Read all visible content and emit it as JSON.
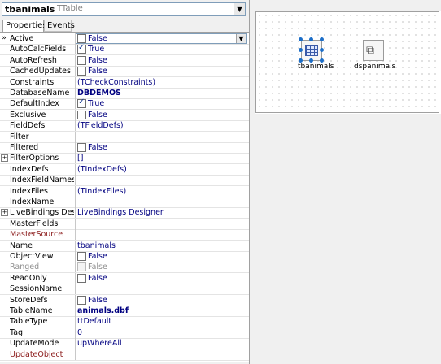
{
  "object_selector": {
    "name": "tbanimals",
    "class_name": "TTable"
  },
  "tabs": [
    {
      "label": "Properties"
    },
    {
      "label": "Events"
    }
  ],
  "properties": [
    {
      "name": "Active",
      "value": "False",
      "kind": "check",
      "checked": false,
      "editing": true
    },
    {
      "name": "AutoCalcFields",
      "value": "True",
      "kind": "check",
      "checked": true
    },
    {
      "name": "AutoRefresh",
      "value": "False",
      "kind": "check",
      "checked": false
    },
    {
      "name": "CachedUpdates",
      "value": "False",
      "kind": "check",
      "checked": false
    },
    {
      "name": "Constraints",
      "value": "(TCheckConstraints)",
      "kind": "navy"
    },
    {
      "name": "DatabaseName",
      "value": "DBDEMOS",
      "kind": "bold"
    },
    {
      "name": "DefaultIndex",
      "value": "True",
      "kind": "check",
      "checked": true
    },
    {
      "name": "Exclusive",
      "value": "False",
      "kind": "check",
      "checked": false
    },
    {
      "name": "FieldDefs",
      "value": "(TFieldDefs)",
      "kind": "navy"
    },
    {
      "name": "Filter",
      "value": "",
      "kind": "text"
    },
    {
      "name": "Filtered",
      "value": "False",
      "kind": "check",
      "checked": false
    },
    {
      "name": "FilterOptions",
      "value": "[]",
      "kind": "navy",
      "expandable": true
    },
    {
      "name": "IndexDefs",
      "value": "(TIndexDefs)",
      "kind": "navy"
    },
    {
      "name": "IndexFieldNames",
      "value": "",
      "kind": "text"
    },
    {
      "name": "IndexFiles",
      "value": "(TIndexFiles)",
      "kind": "navy"
    },
    {
      "name": "IndexName",
      "value": "",
      "kind": "text"
    },
    {
      "name": "LiveBindings Designer",
      "value": "LiveBindings Designer",
      "kind": "navy",
      "expandable": true
    },
    {
      "name": "MasterFields",
      "value": "",
      "kind": "text"
    },
    {
      "name": "MasterSource",
      "value": "",
      "kind": "text",
      "style": "ref"
    },
    {
      "name": "Name",
      "value": "tbanimals",
      "kind": "navy"
    },
    {
      "name": "ObjectView",
      "value": "False",
      "kind": "check",
      "checked": false
    },
    {
      "name": "Ranged",
      "value": "False",
      "kind": "check",
      "checked": false,
      "disabled": true
    },
    {
      "name": "ReadOnly",
      "value": "False",
      "kind": "check",
      "checked": false
    },
    {
      "name": "SessionName",
      "value": "",
      "kind": "text"
    },
    {
      "name": "StoreDefs",
      "value": "False",
      "kind": "check",
      "checked": false
    },
    {
      "name": "TableName",
      "value": "animals.dbf",
      "kind": "bold"
    },
    {
      "name": "TableType",
      "value": "ttDefault",
      "kind": "navy"
    },
    {
      "name": "Tag",
      "value": "0",
      "kind": "navy"
    },
    {
      "name": "UpdateMode",
      "value": "upWhereAll",
      "kind": "navy"
    },
    {
      "name": "UpdateObject",
      "value": "",
      "kind": "text",
      "style": "ref"
    }
  ],
  "designer": {
    "components": [
      {
        "label": "tbanimals",
        "icon": "table-icon",
        "selected": true
      },
      {
        "label": "dspanimals",
        "icon": "datasource-icon",
        "selected": false
      }
    ]
  }
}
